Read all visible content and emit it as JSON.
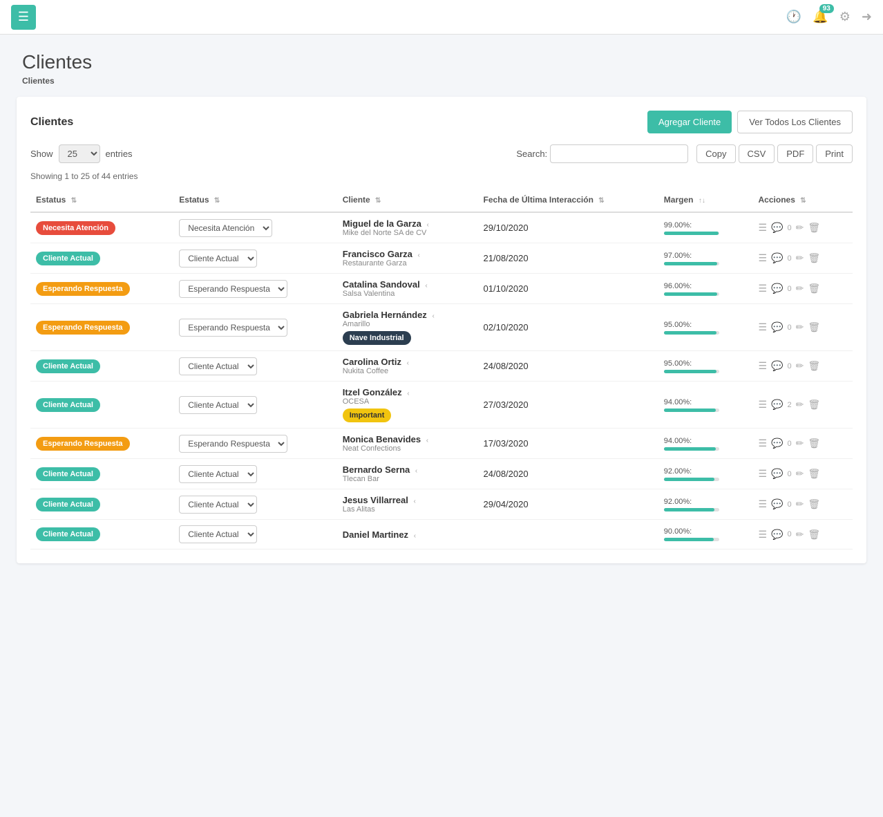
{
  "navbar": {
    "menu_icon": "☰",
    "notification_count": "93",
    "history_icon": "🕐",
    "settings_icon": "⚙",
    "logout_icon": "➜"
  },
  "page": {
    "title": "Clientes",
    "breadcrumb": "Clientes"
  },
  "card": {
    "title": "Clientes",
    "add_button": "Agregar Cliente",
    "view_all_button": "Ver Todos Los Clientes"
  },
  "table_controls": {
    "show_label": "Show",
    "entries_label": "entries",
    "show_value": "25",
    "search_label": "Search:",
    "search_placeholder": "",
    "export_buttons": [
      "Copy",
      "CSV",
      "PDF",
      "Print"
    ]
  },
  "entries_info": "Showing 1 to 25 of 44 entries",
  "columns": [
    "Estatus",
    "Estatus",
    "Cliente",
    "Fecha de Última Interacción",
    "Margen",
    "Acciones"
  ],
  "rows": [
    {
      "badge_label": "Necesita Atención",
      "badge_color": "badge-red",
      "dropdown_label": "Necesita Atención",
      "client_name": "Miguel de la Garza",
      "client_company": "Mike del Norte SA de CV",
      "client_tag": null,
      "date": "29/10/2020",
      "margin_pct": 99,
      "margin_label": "99.00%:",
      "comments": "0"
    },
    {
      "badge_label": "Cliente Actual",
      "badge_color": "badge-teal",
      "dropdown_label": "Cliente Actual",
      "client_name": "Francisco Garza",
      "client_company": "Restaurante Garza",
      "client_tag": null,
      "date": "21/08/2020",
      "margin_pct": 97,
      "margin_label": "97.00%:",
      "comments": "0"
    },
    {
      "badge_label": "Esperando Respuesta",
      "badge_color": "badge-orange",
      "dropdown_label": "Esperando Respuesta",
      "client_name": "Catalina Sandoval",
      "client_company": "Salsa Valentina",
      "client_tag": null,
      "date": "01/10/2020",
      "margin_pct": 96,
      "margin_label": "96.00%:",
      "comments": "0"
    },
    {
      "badge_label": "Esperando Respuesta",
      "badge_color": "badge-orange",
      "dropdown_label": "Esperando Respuesta",
      "client_name": "Gabriela Hernández",
      "client_company": "Amarillo",
      "client_tag": "Nave Industrial",
      "client_tag_color": "badge-navy",
      "date": "02/10/2020",
      "margin_pct": 95,
      "margin_label": "95.00%:",
      "comments": "0"
    },
    {
      "badge_label": "Cliente Actual",
      "badge_color": "badge-teal",
      "dropdown_label": "Cliente Actual",
      "client_name": "Carolina Ortiz",
      "client_company": "Nukita Coffee",
      "client_tag": null,
      "date": "24/08/2020",
      "margin_pct": 95,
      "margin_label": "95.00%:",
      "comments": "0"
    },
    {
      "badge_label": "Cliente Actual",
      "badge_color": "badge-teal",
      "dropdown_label": "Cliente Actual",
      "client_name": "Itzel González",
      "client_company": "OCESA",
      "client_tag": "Important",
      "client_tag_color": "badge-yellow",
      "date": "27/03/2020",
      "margin_pct": 94,
      "margin_label": "94.00%:",
      "comments": "2"
    },
    {
      "badge_label": "Esperando Respuesta",
      "badge_color": "badge-orange",
      "dropdown_label": "Esperando Respuesta",
      "client_name": "Monica Benavides",
      "client_company": "Neat Confections",
      "client_tag": null,
      "date": "17/03/2020",
      "margin_pct": 94,
      "margin_label": "94.00%:",
      "comments": "0"
    },
    {
      "badge_label": "Cliente Actual",
      "badge_color": "badge-teal",
      "dropdown_label": "Cliente Actual",
      "client_name": "Bernardo Serna",
      "client_company": "Tlecan Bar",
      "client_tag": null,
      "date": "24/08/2020",
      "margin_pct": 92,
      "margin_label": "92.00%:",
      "comments": "0"
    },
    {
      "badge_label": "Cliente Actual",
      "badge_color": "badge-teal",
      "dropdown_label": "Cliente Actual",
      "client_name": "Jesus Villarreal",
      "client_company": "Las Alitas",
      "client_tag": null,
      "date": "29/04/2020",
      "margin_pct": 92,
      "margin_label": "92.00%:",
      "comments": "0"
    },
    {
      "badge_label": "Cliente Actual",
      "badge_color": "badge-teal",
      "dropdown_label": "Cliente Actual",
      "client_name": "Daniel Martinez",
      "client_company": "",
      "client_tag": null,
      "date": "",
      "margin_pct": 90,
      "margin_label": "90.00%:",
      "comments": "0"
    }
  ]
}
